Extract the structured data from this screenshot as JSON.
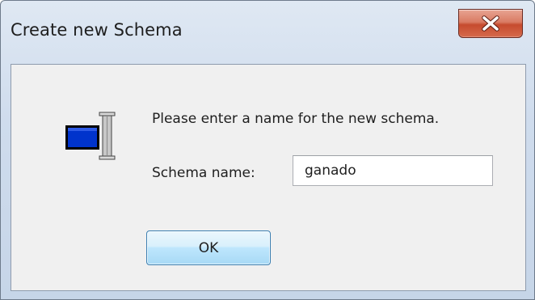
{
  "window": {
    "title": "Create new Schema"
  },
  "icons": {
    "close": "close-icon",
    "app": "input-field-icon"
  },
  "dialog": {
    "message": "Please enter a name for the new schema.",
    "field_label": "Schema name:",
    "field_value": "ganado",
    "ok_label": "OK"
  },
  "colors": {
    "close_button": "#c64b2e",
    "ok_button_border": "#3c7fb1",
    "icon_blue": "#0033cc"
  }
}
